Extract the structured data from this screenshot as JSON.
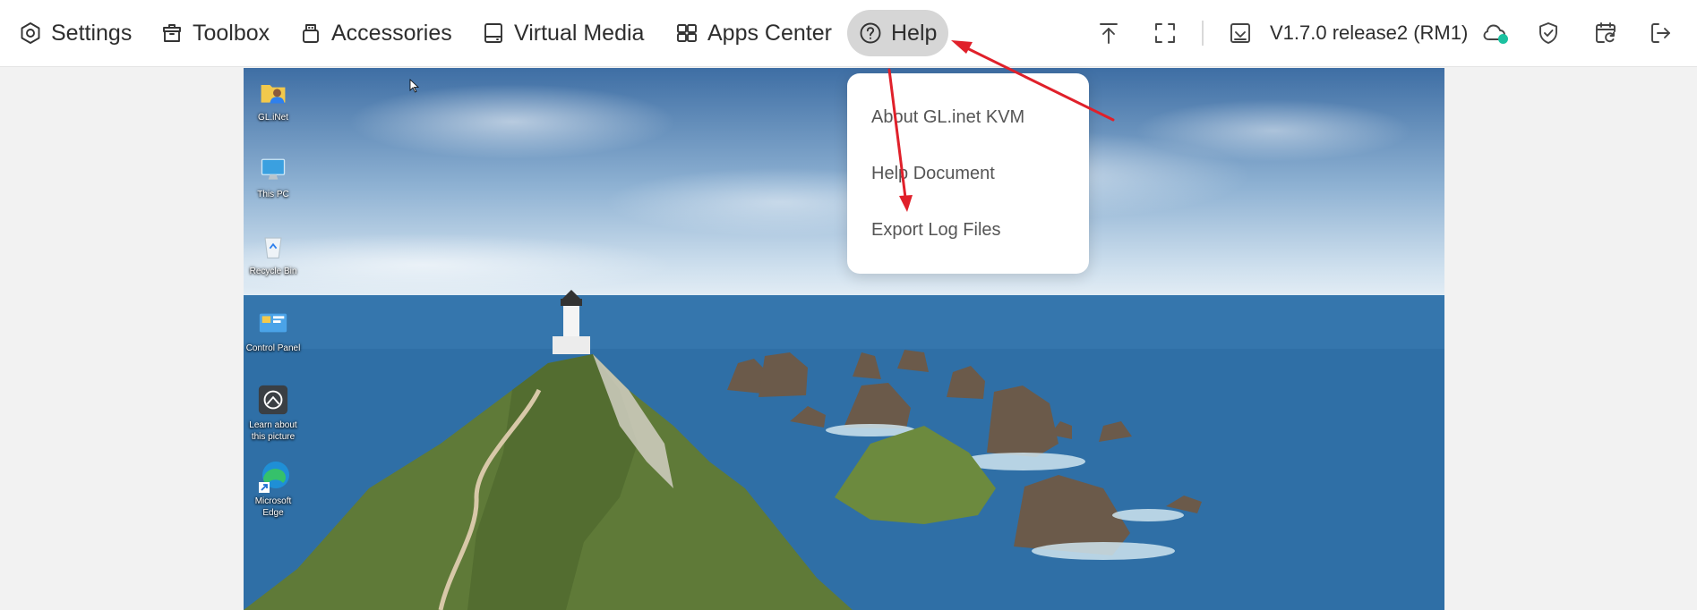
{
  "toolbar": {
    "menu": [
      {
        "label": "Settings",
        "icon": "settings-icon"
      },
      {
        "label": "Toolbox",
        "icon": "toolbox-icon"
      },
      {
        "label": "Accessories",
        "icon": "accessories-icon"
      },
      {
        "label": "Virtual Media",
        "icon": "virtual-media-icon"
      },
      {
        "label": "Apps Center",
        "icon": "apps-center-icon"
      },
      {
        "label": "Help",
        "icon": "help-icon",
        "active": true
      }
    ],
    "right_tools": [
      "upload-icon",
      "fullscreen-icon",
      "update-icon",
      "cloud-icon",
      "shield-icon",
      "calendar-refresh-icon",
      "logout-icon"
    ],
    "version": "V1.7.0 release2 (RM1)",
    "cloud_status_color": "#1bc1a0"
  },
  "help_menu": {
    "items": [
      "About GL.inet KVM",
      "Help Document",
      "Export Log Files"
    ]
  },
  "desktop": {
    "icons": [
      {
        "label": "GL.iNet",
        "icon": "folder-user-icon"
      },
      {
        "label": "This PC",
        "icon": "this-pc-icon"
      },
      {
        "label": "Recycle Bin",
        "icon": "recycle-bin-icon"
      },
      {
        "label": "Control Panel",
        "icon": "control-panel-icon"
      },
      {
        "label": "Learn about this picture",
        "icon": "learn-picture-icon"
      },
      {
        "label": "Microsoft Edge",
        "icon": "edge-icon"
      }
    ]
  },
  "annotation_color": "#e0202a"
}
